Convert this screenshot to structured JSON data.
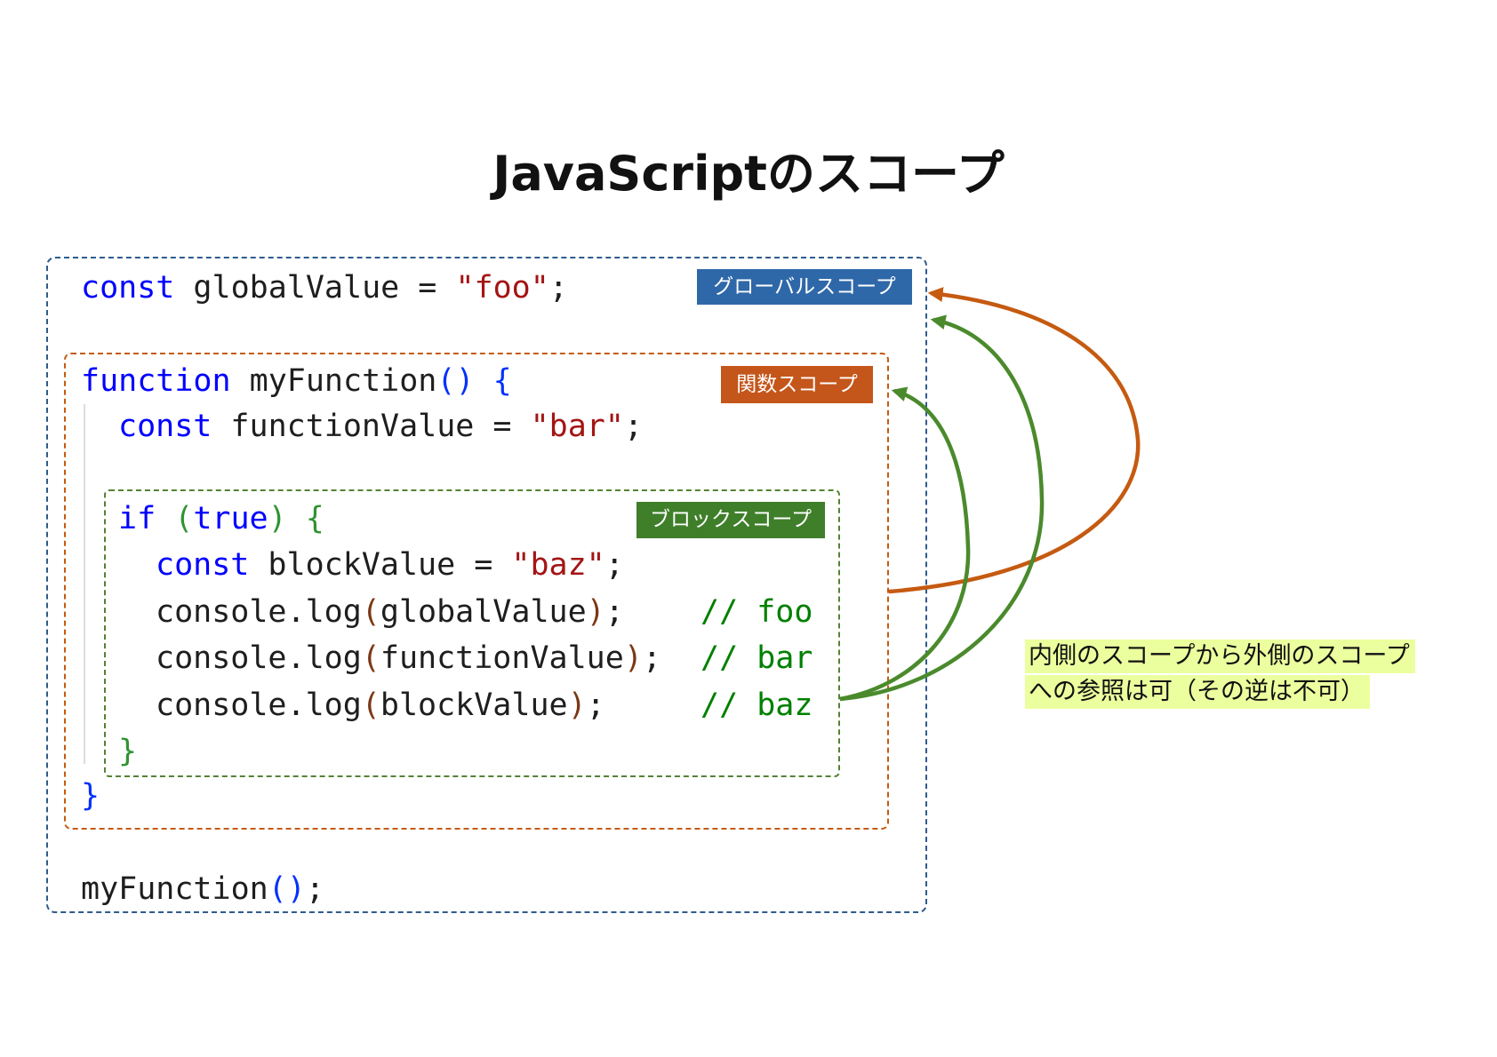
{
  "title": "JavaScriptのスコープ",
  "scope_labels": {
    "global": "グローバルスコープ",
    "function": "関数スコープ",
    "block": "ブロックスコープ"
  },
  "code": {
    "lines": [
      [
        {
          "text": "const",
          "syntax": "keyword"
        },
        {
          "text": " globalValue = ",
          "syntax": "plain"
        },
        {
          "text": "\"foo\"",
          "syntax": "string"
        },
        {
          "text": ";",
          "syntax": "plain"
        }
      ],
      [
        {
          "text": "function",
          "syntax": "keyword"
        },
        {
          "text": " myFunction",
          "syntax": "plain"
        },
        {
          "text": "()",
          "syntax": "bracket1"
        },
        {
          "text": " ",
          "syntax": "plain"
        },
        {
          "text": "{",
          "syntax": "bracket1"
        }
      ],
      [
        {
          "text": "const",
          "syntax": "keyword"
        },
        {
          "text": " functionValue = ",
          "syntax": "plain"
        },
        {
          "text": "\"bar\"",
          "syntax": "string"
        },
        {
          "text": ";",
          "syntax": "plain"
        }
      ],
      [
        {
          "text": "if",
          "syntax": "keyword"
        },
        {
          "text": " ",
          "syntax": "plain"
        },
        {
          "text": "(",
          "syntax": "bracket2"
        },
        {
          "text": "true",
          "syntax": "keyword"
        },
        {
          "text": ")",
          "syntax": "bracket2"
        },
        {
          "text": " ",
          "syntax": "plain"
        },
        {
          "text": "{",
          "syntax": "bracket2"
        }
      ],
      [
        {
          "text": "const",
          "syntax": "keyword"
        },
        {
          "text": " blockValue = ",
          "syntax": "plain"
        },
        {
          "text": "\"baz\"",
          "syntax": "string"
        },
        {
          "text": ";",
          "syntax": "plain"
        }
      ],
      [
        {
          "text": "console.log",
          "syntax": "plain"
        },
        {
          "text": "(",
          "syntax": "bracket3"
        },
        {
          "text": "globalValue",
          "syntax": "plain"
        },
        {
          "text": ")",
          "syntax": "bracket3"
        },
        {
          "text": ";",
          "syntax": "plain"
        }
      ],
      [
        {
          "text": "console.log",
          "syntax": "plain"
        },
        {
          "text": "(",
          "syntax": "bracket3"
        },
        {
          "text": "functionValue",
          "syntax": "plain"
        },
        {
          "text": ")",
          "syntax": "bracket3"
        },
        {
          "text": ";",
          "syntax": "plain"
        }
      ],
      [
        {
          "text": "console.log",
          "syntax": "plain"
        },
        {
          "text": "(",
          "syntax": "bracket3"
        },
        {
          "text": "blockValue",
          "syntax": "plain"
        },
        {
          "text": ")",
          "syntax": "bracket3"
        },
        {
          "text": ";",
          "syntax": "plain"
        }
      ],
      [
        {
          "text": "}",
          "syntax": "bracket2"
        }
      ],
      [
        {
          "text": "}",
          "syntax": "bracket1"
        }
      ],
      [
        {
          "text": "myFunction",
          "syntax": "plain"
        },
        {
          "text": "()",
          "syntax": "bracket1"
        },
        {
          "text": ";",
          "syntax": "plain"
        }
      ]
    ],
    "comments": [
      "// foo",
      "// bar",
      "// baz"
    ]
  },
  "note": {
    "lines": [
      "内側のスコープから外側のスコープ",
      "への参照は可（その逆は不可）"
    ]
  },
  "colors": {
    "keyword": "#0000ff",
    "plain": "#1e1e1e",
    "string": "#a31515",
    "comment": "#008000",
    "bracket1": "#0431fa",
    "bracket2": "#319331",
    "bracket3": "#7b3814",
    "global_scope": "#2e5b8c",
    "global_label_bg": "#2f68a8",
    "function_scope": "#c55a11",
    "function_label_bg": "#c4561b",
    "block_scope": "#548235",
    "block_label_bg": "#3f7f2a",
    "arrow_orange": "#c55a11",
    "arrow_green": "#4a8a2c",
    "note_bg": "#ecff9e"
  }
}
